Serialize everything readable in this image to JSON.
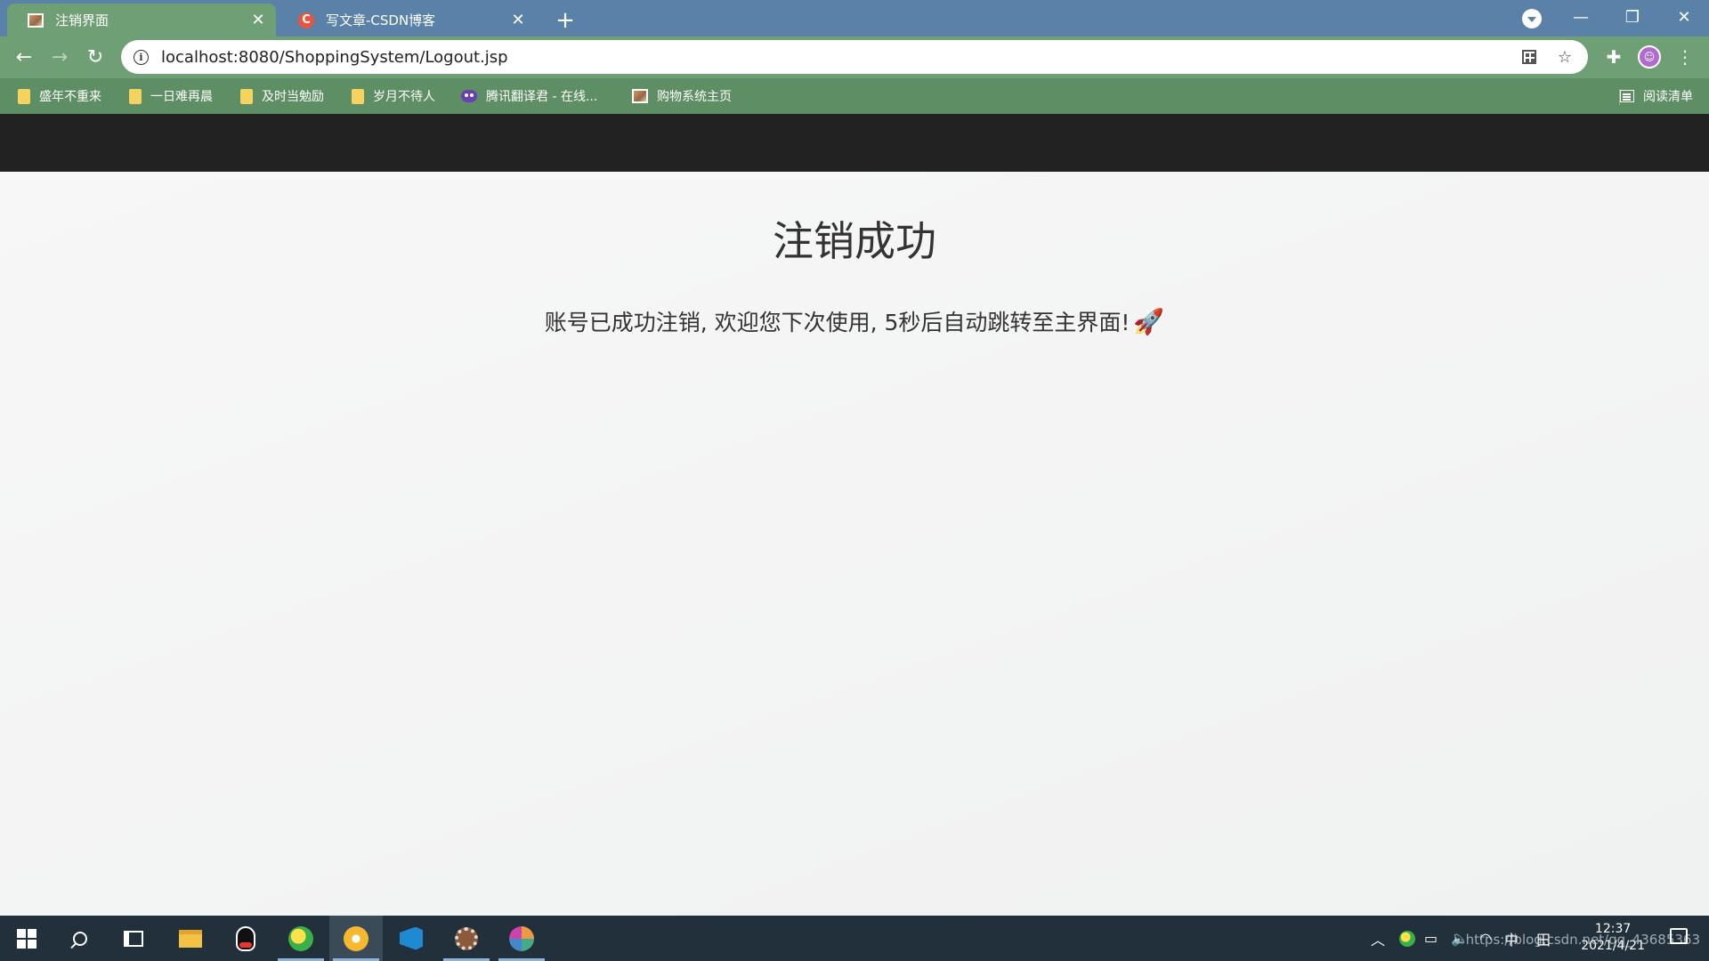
{
  "browser": {
    "tabs": [
      {
        "title": "注销界面",
        "active": true
      },
      {
        "title": "写文章-CSDN博客",
        "active": false
      }
    ],
    "url": "localhost:8080/ShoppingSystem/Logout.jsp",
    "bookmarks": [
      {
        "label": "盛年不重来",
        "icon": "folder-icon"
      },
      {
        "label": "一日难再晨",
        "icon": "folder-icon"
      },
      {
        "label": "及时当勉励",
        "icon": "folder-icon"
      },
      {
        "label": "岁月不待人",
        "icon": "folder-icon"
      },
      {
        "label": "腾讯翻译君 - 在线...",
        "icon": "tencent-translate-icon"
      },
      {
        "label": "购物系统主页",
        "icon": "image-favicon-icon"
      }
    ],
    "reading_list": "阅读清单"
  },
  "page": {
    "title": "注销成功",
    "message": "账号已成功注销, 欢迎您下次使用, 5秒后自动跳转至主界面!",
    "emoji": "🚀"
  },
  "taskbar": {
    "time": "12:37",
    "date": "2021/4/21",
    "ime": "中",
    "watermark": "https://blog.csdn.net/qq_43685363"
  },
  "colors": {
    "tabbar": "#5a82a8",
    "toolbar": "#6f9f74",
    "bookmarks": "#5e8f64",
    "site_header": "#222222",
    "taskbar": "#21303a"
  }
}
